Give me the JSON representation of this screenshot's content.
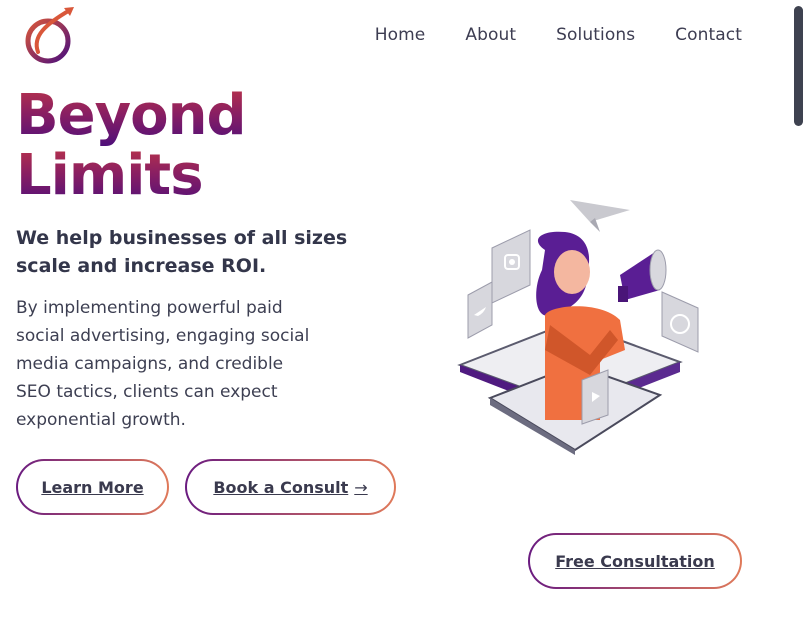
{
  "nav": {
    "items": [
      {
        "label": "Home"
      },
      {
        "label": "About"
      },
      {
        "label": "Solutions"
      },
      {
        "label": "Contact"
      }
    ]
  },
  "hero": {
    "title_line1": "Beyond",
    "title_line2": "Limits",
    "subhead": "We help businesses of all sizes scale and increase ROI.",
    "body": "By implementing powerful paid social advertising, engaging social media campaigns, and credible SEO tactics, clients can expect exponential growth."
  },
  "buttons": {
    "learn_more": "Learn More",
    "book_consult": "Book a Consult",
    "book_arrow": "→",
    "free_consultation": "Free Consultation"
  },
  "colors": {
    "brand_gradient_top": "#b9334a",
    "brand_gradient_bottom": "#4f0f7a",
    "button_border_start": "#6a1b80",
    "button_border_end": "#e07a5a",
    "text_dark": "#3a3a4e"
  },
  "icons": [
    "brand-logo-icon",
    "megaphone-illustration",
    "paper-plane-icon",
    "twitter-icon",
    "instagram-icon",
    "facebook-icon",
    "youtube-icon"
  ]
}
